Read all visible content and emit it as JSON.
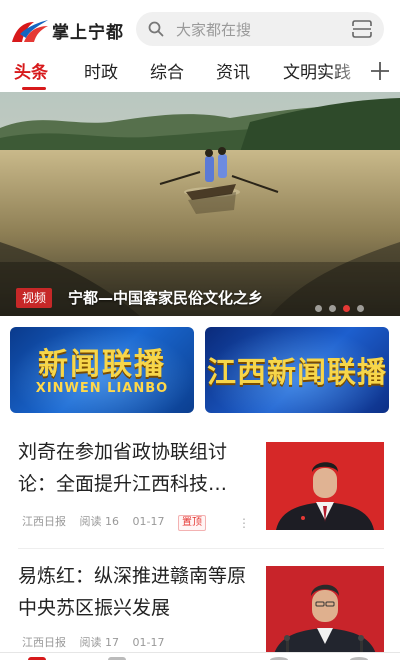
{
  "header": {
    "app_title": "掌上宁都",
    "search_placeholder": "大家都在搜"
  },
  "tabs": [
    {
      "label": "头条",
      "active": true
    },
    {
      "label": "时政",
      "active": false
    },
    {
      "label": "综合",
      "active": false
    },
    {
      "label": "资讯",
      "active": false
    },
    {
      "label": "文明实践",
      "active": false
    }
  ],
  "hero": {
    "tag": "视频",
    "caption": "宁都—中国客家民俗文化之乡",
    "slide_count": 4,
    "active_slide": 3
  },
  "banners": [
    {
      "title": "新闻联播",
      "subtitle": "XINWEN LIANBO"
    },
    {
      "title": "江西新闻联播"
    }
  ],
  "news": [
    {
      "title": "刘奇在参加省政协联组讨论：全面提升江西科技…",
      "source": "江西日报",
      "reads": "阅读 16",
      "date": "01-17",
      "tag": "置顶"
    },
    {
      "title": "易炼红：纵深推进赣南等原中央苏区振兴发展",
      "source": "江西日报",
      "reads": "阅读 17",
      "date": "01-17"
    }
  ],
  "colors": {
    "accent": "#d7191b",
    "banner_gold": "#f7d64a"
  },
  "icons": {
    "search": "search-icon",
    "scan": "scan-icon",
    "add_channel": "plus-icon",
    "more": "more-dots-icon"
  }
}
